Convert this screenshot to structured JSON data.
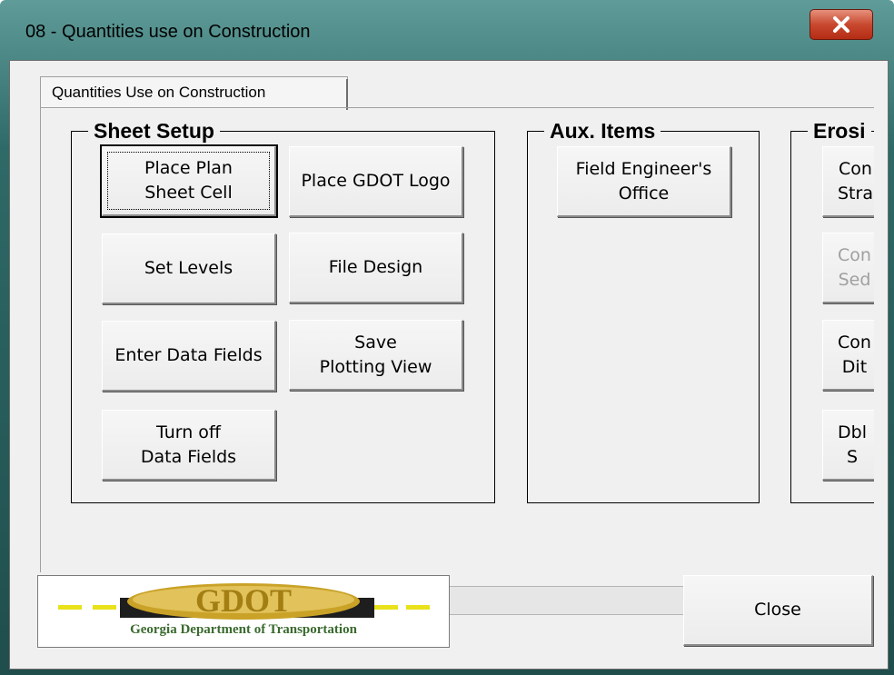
{
  "window": {
    "title": "08 - Quantities use on Construction"
  },
  "tabs": [
    {
      "label": "Quantities Use on Construction"
    }
  ],
  "frames": {
    "sheet_setup": {
      "title": "Sheet Setup",
      "buttons": {
        "place_plan_sheet_cell": "Place Plan\nSheet Cell",
        "place_gdot_logo": "Place GDOT Logo",
        "set_levels": "Set Levels",
        "file_design": "File Design",
        "enter_data_fields": "Enter Data Fields",
        "save_plotting_view": "Save\nPlotting View",
        "turn_off_data_fields": "Turn off\nData Fields"
      }
    },
    "aux_items": {
      "title": "Aux. Items",
      "buttons": {
        "field_engineers_office": "Field Engineer's\nOffice"
      }
    },
    "erosion": {
      "title": "Erosi",
      "buttons": {
        "con_stra": "Con\nStra",
        "con_sed": "Con\nSed",
        "con_dit": "Con\n Dit",
        "dbl_s": "Dbl\n S"
      }
    }
  },
  "logo": {
    "wordmark": "GDOT",
    "caption": "Georgia Department of Transportation"
  },
  "footer": {
    "close_label": "Close"
  },
  "icons": {
    "window_close": "close-x-icon",
    "scroll_left": "arrow-left-icon",
    "scroll_right": "arrow-right-icon"
  },
  "colors": {
    "dialog_bg": "#f0f0f0",
    "title_close_red": "#c8492f",
    "logo_gold": "#c9a227",
    "logo_green": "#3a6a2e"
  }
}
